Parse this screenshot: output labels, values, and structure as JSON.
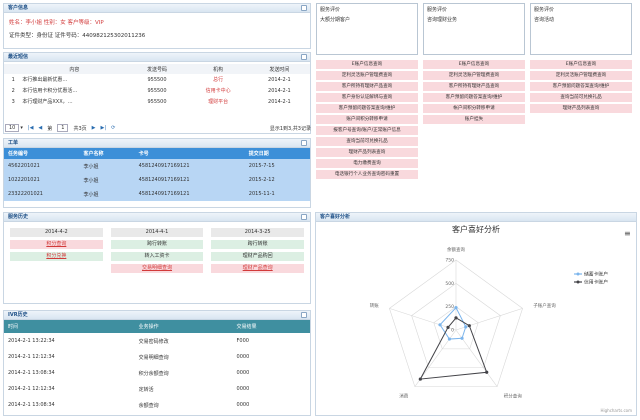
{
  "customer": {
    "title": "客户信息",
    "line1": "姓名：李小姐 性别：女 客户等级：VIP",
    "line2": "证件类型：身份证 证件号码：440982125302011236"
  },
  "recent": {
    "title": "最近短信",
    "headers": [
      "内容",
      "发送号码",
      "机构",
      "发送时间"
    ],
    "rows": [
      {
        "n": "1",
        "content": "本行推出最新优惠…",
        "num": "955500",
        "org": "总行",
        "time": "2014-2-1"
      },
      {
        "n": "2",
        "content": "本行信用卡积分优惠活…",
        "num": "955500",
        "org": "信用卡中心",
        "time": "2014-2-1"
      },
      {
        "n": "3",
        "content": "本行理财产品XXX，…",
        "num": "955500",
        "org": "理财平台",
        "time": "2014-2-1"
      }
    ]
  },
  "pager": {
    "size": "10",
    "page_label": "第",
    "page": "1",
    "total": "共3页",
    "info": "显示1到3,共3记录"
  },
  "workorders": {
    "title": "工单",
    "headers": [
      "任务编号",
      "客户名称",
      "卡号",
      "提交日期"
    ],
    "rows": [
      {
        "id": "4562201021",
        "name": "李小姐",
        "card": "4581240917169121",
        "date": "2015-7-15"
      },
      {
        "id": "1022201021",
        "name": "李小姐",
        "card": "4581240917169121",
        "date": "2015-2-12"
      },
      {
        "id": "23322201021",
        "name": "李小姐",
        "card": "4581240917169121",
        "date": "2015-11-1"
      }
    ]
  },
  "service": {
    "title": "服务历史",
    "cols": [
      {
        "date": "2014-4-2",
        "items": [
          "积分查询",
          "积分兑换"
        ]
      },
      {
        "date": "2014-4-1",
        "items": [
          "跨行转账",
          "转入工资卡",
          "交易明细查询"
        ]
      },
      {
        "date": "2014-3-25",
        "items": [
          "跨行转账",
          "理财产品购回",
          "理财产品查询"
        ]
      }
    ]
  },
  "ivr": {
    "title": "IVR历史",
    "headers": [
      "时间",
      "业务操作",
      "交易结果"
    ],
    "rows": [
      {
        "t": "2014-2-1 13:22:34",
        "op": "交易密码修改",
        "r": "F000"
      },
      {
        "t": "2014-2-1 12:12:34",
        "op": "交易明细查询",
        "r": "0000"
      },
      {
        "t": "2014-2-1 13:08:34",
        "op": "积分余额查询",
        "r": "0000"
      },
      {
        "t": "2014-2-1 12:12:34",
        "op": "定转活",
        "r": "0000"
      },
      {
        "t": "2014-2-1 13:08:34",
        "op": "余额查询",
        "r": "0000"
      }
    ]
  },
  "recommend": {
    "cols": [
      {
        "header": "服务评价",
        "seg": "大额分期客户",
        "items": [
          "E账户信息查询",
          "定利灵活账户管理费查询",
          "客户所持有理财产品查询",
          "客户身份认证解绑与查询",
          "客户预留问题答案查询/维护",
          "账户间积分转移申请",
          "报客户号查询/账户/正常账户信息",
          "查询当前可兑换礼品",
          "理财产品列表查询",
          "电力缴费查询",
          "电话银行个人业务查询密码重置"
        ]
      },
      {
        "header": "服务评价",
        "seg": "咨询理财业务",
        "items": [
          "E账户信息查询",
          "定利灵活账户管理费查询",
          "客户所持有理财产品查询",
          "客户预留问题答案查询/维护",
          "帐户间积分转移申请",
          "账户挂失"
        ]
      },
      {
        "header": "服务评价",
        "seg": "咨询活动",
        "items": [
          "E账户信息查询",
          "定利灵活账户管理费查询",
          "客户预留问题答案查询/维护",
          "查询当前可兑换礼品",
          "理财产品列表查询"
        ]
      }
    ]
  },
  "chart_panel_title": "客户喜好分析",
  "chart_data": {
    "type": "radar",
    "title": "客户喜好分析",
    "axes": [
      "余额查询",
      "子账户查询",
      "积分查询",
      "消费",
      "转账"
    ],
    "rlim": [
      0,
      750
    ],
    "rticks": [
      0,
      250,
      500,
      750
    ],
    "grid": true,
    "legend": "right",
    "series": [
      {
        "name": "储蓄卡账户",
        "color": "#7cb5ec",
        "values": [
          240,
          110,
          110,
          120,
          180
        ]
      },
      {
        "name": "信用卡账户",
        "color": "#434348",
        "values": [
          130,
          150,
          560,
          650,
          90
        ]
      }
    ],
    "credit": "Highcharts.com"
  }
}
